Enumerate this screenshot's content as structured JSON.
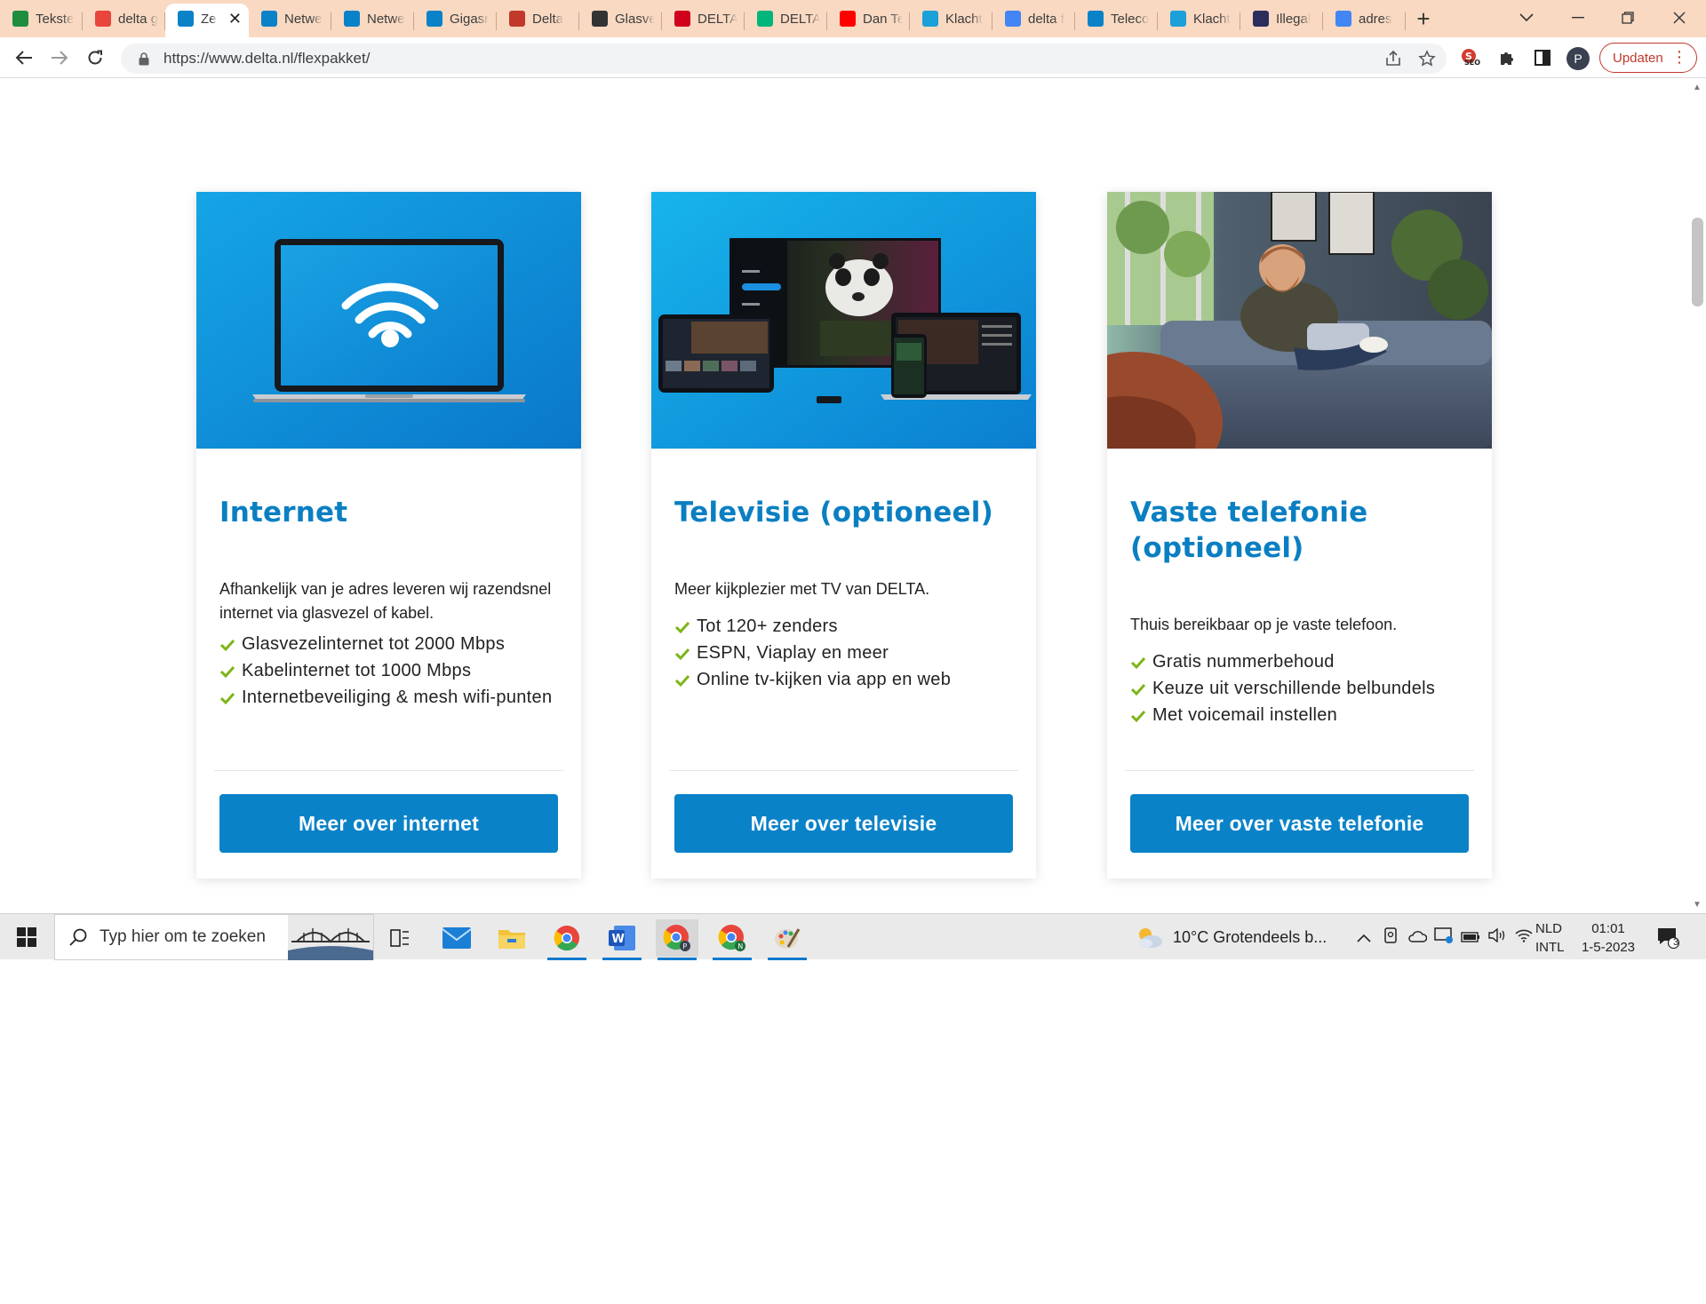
{
  "browser": {
    "tabs": [
      {
        "title": "Tekste",
        "favicon": "sheets-icon",
        "color": "#1e8e3e"
      },
      {
        "title": "delta g",
        "favicon": "chart-icon",
        "color": "#e8453c"
      },
      {
        "title": "Ze",
        "favicon": "delta-icon",
        "color": "#0a82c8",
        "active": true
      },
      {
        "title": "Netwe",
        "favicon": "delta-icon",
        "color": "#0a82c8"
      },
      {
        "title": "Netwe",
        "favicon": "delta-icon",
        "color": "#0a82c8"
      },
      {
        "title": "Gigasr",
        "favicon": "delta-icon",
        "color": "#0a82c8"
      },
      {
        "title": "Delta",
        "favicon": "flag-icon",
        "color": "#c0392b"
      },
      {
        "title": "Glasve",
        "favicon": "openai-icon",
        "color": "#333333"
      },
      {
        "title": "DELTA",
        "favicon": "pinterest-icon",
        "color": "#d0021b"
      },
      {
        "title": "DELTA",
        "favicon": "trustpilot-icon",
        "color": "#00b67a"
      },
      {
        "title": "Dan Te",
        "favicon": "youtube-icon",
        "color": "#ff0000"
      },
      {
        "title": "Klacht",
        "favicon": "r-icon",
        "color": "#1ba0d7"
      },
      {
        "title": "delta f",
        "favicon": "google-icon",
        "color": "#4285f4"
      },
      {
        "title": "Teleco",
        "favicon": "delta-icon",
        "color": "#0a82c8"
      },
      {
        "title": "Klacht",
        "favicon": "r-icon",
        "color": "#1ba0d7"
      },
      {
        "title": "Illegal",
        "favicon": "nu-icon",
        "color": "#2b2d5c"
      },
      {
        "title": "adres",
        "favicon": "google-icon",
        "color": "#4285f4"
      }
    ],
    "url": "https://www.delta.nl/flexpakket/",
    "update_label": "Updaten",
    "profile_initial": "P"
  },
  "cards": [
    {
      "title": "Internet",
      "description": "Afhankelijk van je adres leveren wij razendsnel internet via glasvezel of kabel.",
      "features": [
        "Glasvezelinternet tot 2000 Mbps",
        "Kabelinternet tot 1000 Mbps",
        "Internetbeveiliging & mesh wifi-punten"
      ],
      "cta": "Meer over internet"
    },
    {
      "title": "Televisie (optioneel)",
      "description": "Meer kijkplezier met TV van DELTA.",
      "features": [
        "Tot 120+ zenders",
        "ESPN, Viaplay en meer",
        "Online tv-kijken via app en web"
      ],
      "cta": "Meer over televisie"
    },
    {
      "title": "Vaste telefonie (optioneel)",
      "description": "Thuis bereikbaar op je vaste telefoon.",
      "features": [
        "Gratis nummerbehoud",
        "Keuze uit verschillende belbundels",
        "Met voicemail instellen"
      ],
      "cta": "Meer over vaste telefonie"
    }
  ],
  "taskbar": {
    "search_placeholder": "Typ hier om te zoeken",
    "weather": "10°C  Grotendeels b...",
    "lang_top": "NLD",
    "lang_bottom": "INTL",
    "time": "01:01",
    "date": "1-5-2023",
    "notification_count": "3"
  },
  "colors": {
    "brand_blue": "#0a82c8",
    "check_green": "#7cb518",
    "tabstrip": "#f9d9c2"
  }
}
